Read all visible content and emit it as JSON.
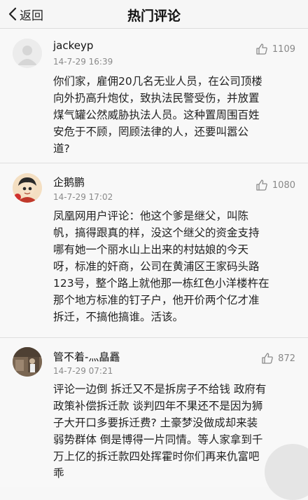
{
  "header": {
    "back_label": "返回",
    "title": "热门评论"
  },
  "comments": [
    {
      "user": "jackeyp",
      "time": "14-7-29 16:39",
      "likes": "1109",
      "text": "你们家，雇佣20几名无业人员，在公司顶楼\n向外扔高升炮仗，致执法民警受伤，并放置\n煤气罐公然威胁执法人员。这种置周围百姓\n安危于不顾，罔顾法律的人，还要叫嚣公\n道?"
    },
    {
      "user": "企鹅鹏",
      "time": "14-7-29 17:02",
      "likes": "1080",
      "text": "凤凰网用户评论：他这个爹是继父，叫陈\n帆，搞得跟真的样，没这个继父的资金支持\n哪有她一个丽水山上出来的村姑娘的今天\n呀，标准的奸商，公司在黄浦区王家码头路\n123号，整个路上就他那一栋红色小洋楼杵在\n那个地方标准的钉子户，他开价两个亿才准\n拆迁，不搞他搞谁。活该。"
    },
    {
      "user": "管不着-灬皛靐",
      "time": "14-7-29 07:21",
      "likes": "872",
      "text": "评论一边倒 拆迁又不是拆房子不给钱 政府有\n政策补偿拆迁款 谈判四年不果还不是因为狮\n子大开口多要拆迁费? 土豪梦没做成却来装\n弱势群体 倒是博得一片同情。等人家拿到千\n万上亿的拆迁款四处挥霍时你们再来仇富吧\n乖"
    }
  ],
  "icons": {
    "back": "chevron-left-icon",
    "like": "thumbs-up-icon"
  }
}
